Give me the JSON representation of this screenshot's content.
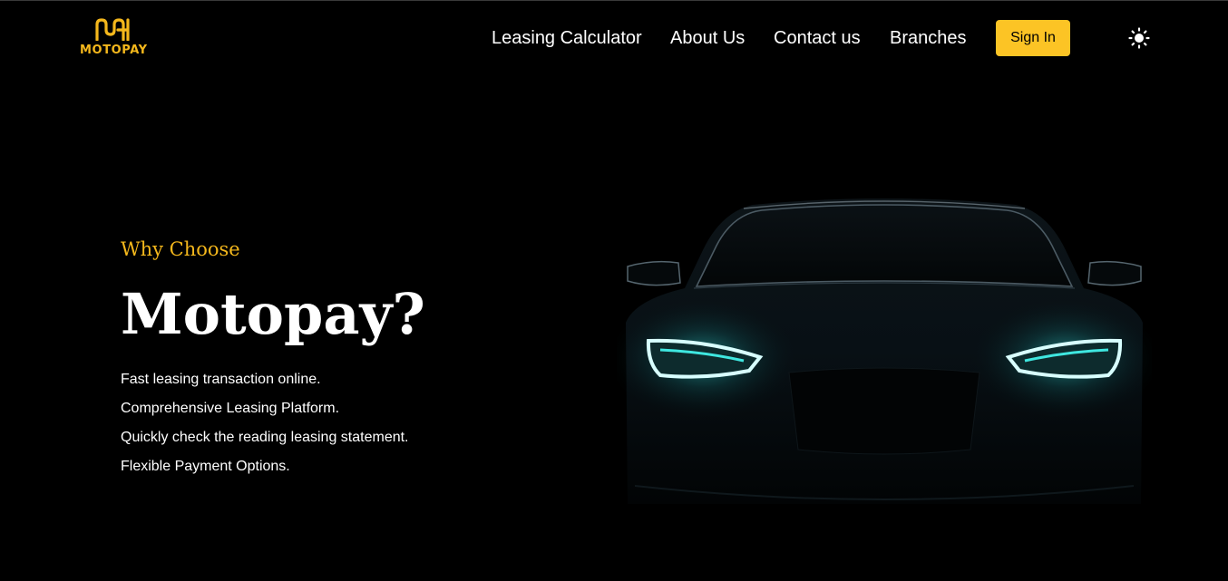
{
  "brand": {
    "name": "MOTOPAY",
    "accent_color": "#f5b81c",
    "logo_icon": "motopay-logo-mark"
  },
  "nav": {
    "items": [
      "Leasing Calculator",
      "About Us",
      "Contact us",
      "Branches"
    ],
    "signin_label": "Sign In",
    "signin_color": "#fcc425",
    "theme_icon": "sun-icon"
  },
  "hero": {
    "kicker": "Why Choose",
    "headline": "Motopay?",
    "features": [
      "Fast leasing transaction online.",
      "Comprehensive Leasing Platform.",
      "Quickly check the reading leasing statement.",
      "Flexible Payment Options."
    ],
    "image_icon": "car-front-headlights",
    "headlight_color": "#3fe7e0"
  }
}
